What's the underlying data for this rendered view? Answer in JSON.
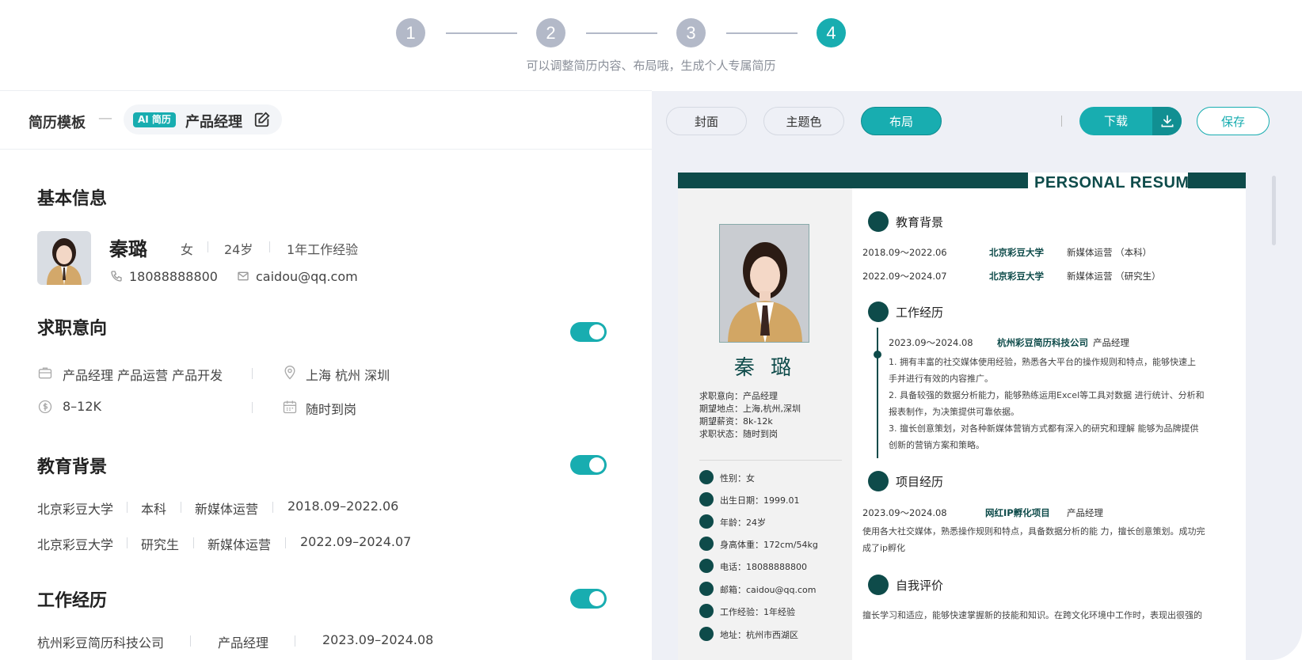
{
  "stepper": {
    "steps": [
      "1",
      "2",
      "3",
      "4"
    ],
    "active_step": 4,
    "hint": "可以调整简历内容、布局哦，生成个人专属简历"
  },
  "left_header": {
    "title": "简历模板",
    "dash": "—",
    "ai_badge": "AI 简历",
    "template_name": "产品经理"
  },
  "basic_info": {
    "title": "基本信息",
    "name": "秦璐",
    "gender": "女",
    "age": "24岁",
    "experience": "1年工作经验",
    "phone": "18088888800",
    "email": "caidou@qq.com"
  },
  "job_intent": {
    "title": "求职意向",
    "enabled": true,
    "positions": "产品经理 产品运营 产品开发",
    "cities": "上海  杭州  深圳",
    "salary": "8–12K",
    "availability": "随时到岗"
  },
  "education": {
    "title": "教育背景",
    "enabled": true,
    "rows": [
      {
        "school": "北京彩豆大学",
        "degree": "本科",
        "major": "新媒体运营",
        "period": "2018.09–2022.06"
      },
      {
        "school": "北京彩豆大学",
        "degree": "研究生",
        "major": "新媒体运营",
        "period": "2022.09–2024.07"
      }
    ]
  },
  "work": {
    "title": "工作经历",
    "enabled": true,
    "rows": [
      {
        "company": "杭州彩豆简历科技公司",
        "role": "产品经理",
        "period": "2023.09–2024.08"
      }
    ]
  },
  "toolbar": {
    "cover": "封面",
    "theme_color": "主题色",
    "layout": "布局",
    "download": "下载",
    "save": "保存"
  },
  "resume": {
    "banner": "PERSONAL RESUME",
    "name": "秦 璐",
    "intent_lines": [
      "求职意向：产品经理",
      "期望地点：上海,杭州,深圳",
      "期望薪资：8k-12k",
      "求职状态：随时到岗"
    ],
    "info_lines": [
      {
        "icon": "gender-icon",
        "text": "性别：女"
      },
      {
        "icon": "birthday-icon",
        "text": "出生日期：1999.01"
      },
      {
        "icon": "calendar-icon",
        "text": "年龄：24岁"
      },
      {
        "icon": "body-icon",
        "text": "身高体重：172cm/54kg"
      },
      {
        "icon": "phone-icon",
        "text": "电话：18088888800"
      },
      {
        "icon": "mail-icon",
        "text": "邮箱：caidou@qq.com"
      },
      {
        "icon": "briefcase-icon",
        "text": "工作经验：1年经验"
      },
      {
        "icon": "location-icon",
        "text": "地址：杭州市西湖区"
      }
    ],
    "edu_title": "教育背景",
    "edu_rows": [
      {
        "period": "2018.09～2022.06",
        "school": "北京彩豆大学",
        "major": "新媒体运营 （本科）"
      },
      {
        "period": "2022.09～2024.07",
        "school": "北京彩豆大学",
        "major": "新媒体运营 （研究生）"
      }
    ],
    "work_title": "工作经历",
    "work_row": {
      "period": "2023.09～2024.08",
      "company": "杭州彩豆简历科技公司",
      "role": "产品经理"
    },
    "work_points": [
      "1. 拥有丰富的社交媒体使用经验，熟悉各大平台的操作规则和特点，能够快速上",
      "手并进行有效的内容推广。",
      "2. 具备较强的数据分析能力，能够熟练运用Excel等工具对数据 进行统计、分析和",
      "报表制作，为决策提供可靠依据。",
      "3. 擅长创意策划，对各种新媒体营销方式都有深入的研究和理解 能够为品牌提供",
      "创新的营销方案和策略。"
    ],
    "project_title": "项目经历",
    "project_row": {
      "period": "2023.09～2024.08",
      "name": "网红IP孵化项目",
      "role": "产品经理"
    },
    "project_desc": [
      "使用各大社交媒体，熟悉操作规则和特点，具备数据分析的能 力，擅长创意策划。成功完",
      "成了ip孵化"
    ],
    "self_title": "自我评价",
    "self_desc": "擅长学习和适应，能够快速掌握新的技能和知识。在跨文化环境中工作时，表现出很强的"
  },
  "colors": {
    "accent": "#18adb0",
    "resume_dark": "#0e4b4a",
    "step_inactive": "#b3b9c8"
  }
}
